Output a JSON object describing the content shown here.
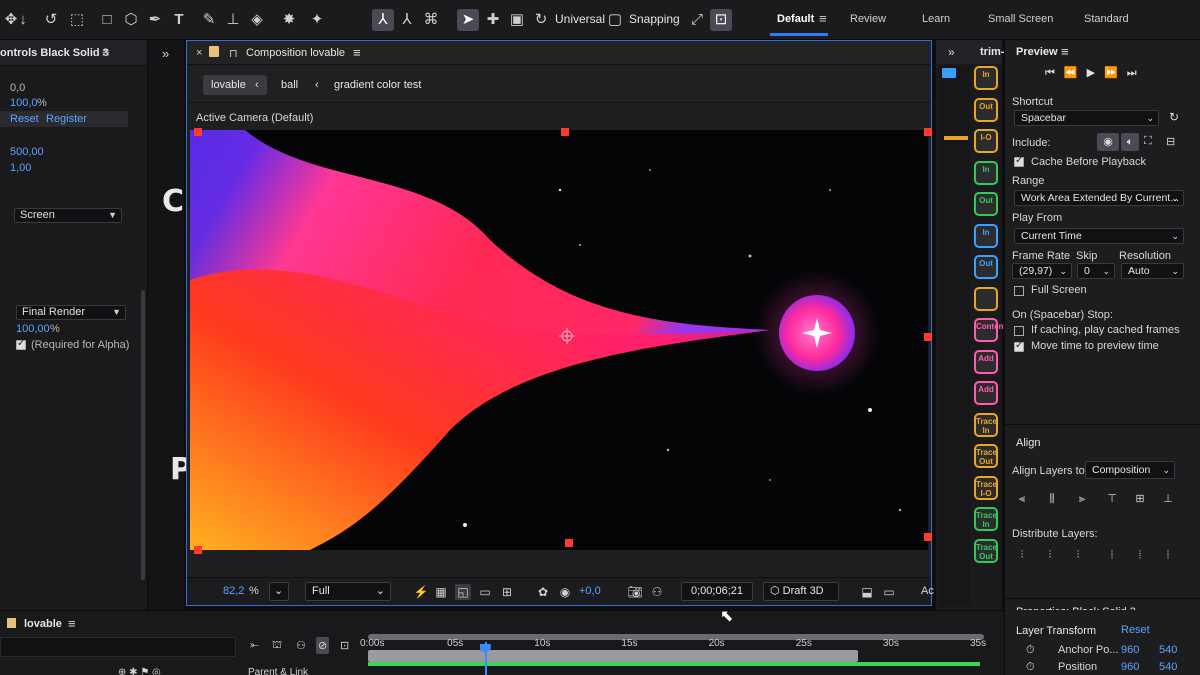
{
  "toolbar": {
    "universal_label": "Universal",
    "snapping_label": "Snapping",
    "workspaces": [
      "Default",
      "Review",
      "Learn",
      "Small Screen",
      "Standard"
    ]
  },
  "effect_controls": {
    "tab_title": "ontrols Black Solid 3",
    "val_1": "0,0",
    "val_2": "100,0",
    "val_2_unit": "%",
    "reset": "Reset",
    "register": "Register",
    "val_3": "500,00",
    "val_4": "1,00",
    "blend_mode": "Screen",
    "render_mode": "Final Render",
    "render_pct": "100,00",
    "render_pct_unit": "%",
    "alpha_note": "(Required for Alpha)"
  },
  "strip_letters": [
    "C",
    "P"
  ],
  "composition": {
    "header": "Composition lovable",
    "breadcrumbs": [
      "lovable",
      "ball",
      "gradient color test"
    ],
    "camera": "Active Camera (Default)",
    "zoom": "82,2",
    "zoom_unit": "%",
    "resolution": "Full",
    "exposure": "+0,0",
    "timecode": "0;00;06;21",
    "renderer": "Draft 3D",
    "cut_label": "Ac"
  },
  "trim": {
    "title": "trim-",
    "buttons": [
      {
        "label": "In",
        "color": "#e8a628"
      },
      {
        "label": "Out",
        "color": "#e8a628"
      },
      {
        "label": "I-O",
        "color": "#e8a628"
      },
      {
        "label": "In",
        "color": "#33c95a"
      },
      {
        "label": "Out",
        "color": "#33c95a"
      },
      {
        "label": "In",
        "color": "#3aa0ff"
      },
      {
        "label": "Out",
        "color": "#3aa0ff"
      },
      {
        "label": "",
        "color": "#e8a628"
      },
      {
        "label": "Content",
        "color": "#ff5ab4"
      },
      {
        "label": "Add",
        "color": "#ff5ab4"
      },
      {
        "label": "Add",
        "color": "#ff5ab4"
      },
      {
        "label": "Trace In",
        "color": "#e8a628"
      },
      {
        "label": "Trace Out",
        "color": "#e8a628"
      },
      {
        "label": "Trace I-O",
        "color": "#e8a628"
      },
      {
        "label": "Trace In",
        "color": "#33c95a"
      },
      {
        "label": "Trace Out",
        "color": "#33c95a"
      }
    ]
  },
  "preview": {
    "title": "Preview",
    "shortcut_label": "Shortcut",
    "shortcut_value": "Spacebar",
    "include_label": "Include:",
    "cache_before": "Cache Before Playback",
    "range_label": "Range",
    "range_value": "Work Area Extended By Current...",
    "play_from_label": "Play From",
    "play_from_value": "Current Time",
    "frame_rate_label": "Frame Rate",
    "skip_label": "Skip",
    "resolution_label": "Resolution",
    "frame_rate_value": "(29,97)",
    "skip_value": "0",
    "resolution_value": "Auto",
    "full_screen": "Full Screen",
    "on_stop_label": "On (Spacebar) Stop:",
    "if_caching": "If caching, play cached frames",
    "move_time": "Move time to preview time"
  },
  "align": {
    "title": "Align",
    "align_to_label": "Align Layers to:",
    "align_to_value": "Composition",
    "distribute_label": "Distribute Layers:"
  },
  "properties": {
    "title": "Properties: Black Solid 3",
    "layer_transform": "Layer Transform",
    "reset": "Reset",
    "anchor_label": "Anchor Po...",
    "anchor_x": "960",
    "anchor_y": "540",
    "position_label": "Position",
    "position_x": "960",
    "position_y": "540"
  },
  "timeline": {
    "comp_name": "lovable",
    "ticks": [
      "0:00s",
      "05s",
      "10s",
      "15s",
      "20s",
      "25s",
      "30s",
      "35s"
    ],
    "parent_link": "Parent & Link",
    "playhead_seconds": 6.7
  },
  "colors": {
    "accent": "#2f7cf6",
    "handle": "#ff3a2f",
    "link": "#5aa4ff"
  }
}
